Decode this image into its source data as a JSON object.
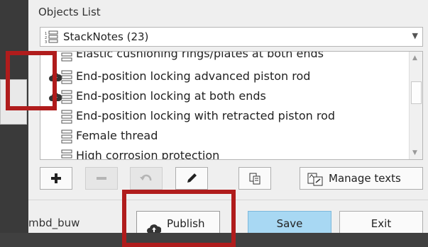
{
  "objects_list": {
    "title": "Objects List",
    "selector": {
      "icon": "stack-notes-icon",
      "value": "StackNotes (23)",
      "expanded": false
    },
    "items": [
      {
        "label": "Elastic cushioning rings/plates at both ends",
        "icon": "stack-note-icon",
        "published": false
      },
      {
        "label": "End-position locking advanced piston rod",
        "icon": "stack-note-icon",
        "published": true
      },
      {
        "label": "End-position locking at both ends",
        "icon": "stack-note-icon",
        "published": true
      },
      {
        "label": "End-position locking with retracted piston rod",
        "icon": "stack-note-icon",
        "published": false
      },
      {
        "label": "Female thread",
        "icon": "stack-note-icon",
        "published": false
      },
      {
        "label": "High corrosion protection",
        "icon": "stack-note-icon",
        "published": false
      }
    ]
  },
  "toolbar": {
    "add": {
      "icon": "plus-icon",
      "enabled": true
    },
    "remove": {
      "icon": "minus-icon",
      "enabled": false
    },
    "undo": {
      "icon": "undo-icon",
      "enabled": false
    },
    "edit": {
      "icon": "pencil-icon",
      "enabled": true
    },
    "copy": {
      "icon": "copy-icon",
      "enabled": true
    },
    "manage_texts": {
      "icon": "manage-texts-icon",
      "label": "Manage texts"
    }
  },
  "footer": {
    "user": "mbd_buw",
    "publish_label": "Publish",
    "save_label": "Save",
    "exit_label": "Exit"
  },
  "colors": {
    "highlight": "#b01c1c",
    "save_button": "#a8d8f3",
    "background": "#efefef"
  }
}
